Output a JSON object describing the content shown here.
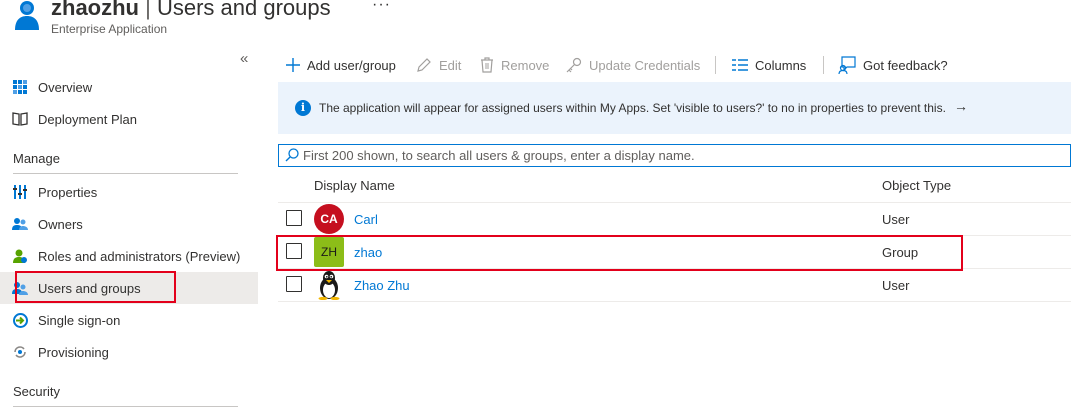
{
  "header": {
    "app_name": "zhaozhu",
    "separator": "|",
    "page_name": "Users and groups",
    "more": "···",
    "subtitle": "Enterprise Application"
  },
  "sidebar": {
    "collapse": "«",
    "items_top": [
      {
        "label": "Overview",
        "icon": "grid-icon"
      },
      {
        "label": "Deployment Plan",
        "icon": "book-icon"
      }
    ],
    "manage_heading": "Manage",
    "manage_items": [
      {
        "label": "Properties",
        "icon": "properties-icon"
      },
      {
        "label": "Owners",
        "icon": "owners-icon"
      },
      {
        "label": "Roles and administrators (Preview)",
        "icon": "roles-icon"
      },
      {
        "label": "Users and groups",
        "icon": "users-groups-icon",
        "active": true
      },
      {
        "label": "Single sign-on",
        "icon": "sso-icon"
      },
      {
        "label": "Provisioning",
        "icon": "provisioning-icon"
      }
    ],
    "security_heading": "Security"
  },
  "toolbar": {
    "add": "Add user/group",
    "edit": "Edit",
    "remove": "Remove",
    "update_credentials": "Update Credentials",
    "columns": "Columns",
    "feedback": "Got feedback?"
  },
  "info": {
    "text": "The application will appear for assigned users within My Apps. Set 'visible to users?' to no in properties to prevent this.",
    "arrow": "→"
  },
  "search": {
    "placeholder": "First 200 shown, to search all users & groups, enter a display name."
  },
  "table": {
    "columns": [
      "Display Name",
      "Object Type"
    ],
    "rows": [
      {
        "initials": "CA",
        "name": "Carl",
        "type": "User",
        "avatar": "circle",
        "avatar_color": "#c50f1f"
      },
      {
        "initials": "ZH",
        "name": "zhao",
        "type": "Group",
        "avatar": "square",
        "avatar_color": "#8cbd18"
      },
      {
        "initials": "",
        "name": "Zhao Zhu",
        "type": "User",
        "avatar": "penguin-icon"
      }
    ]
  },
  "colors": {
    "accent": "#0078d4",
    "highlight": "#e3001b",
    "info_background": "#ebf3fc"
  }
}
